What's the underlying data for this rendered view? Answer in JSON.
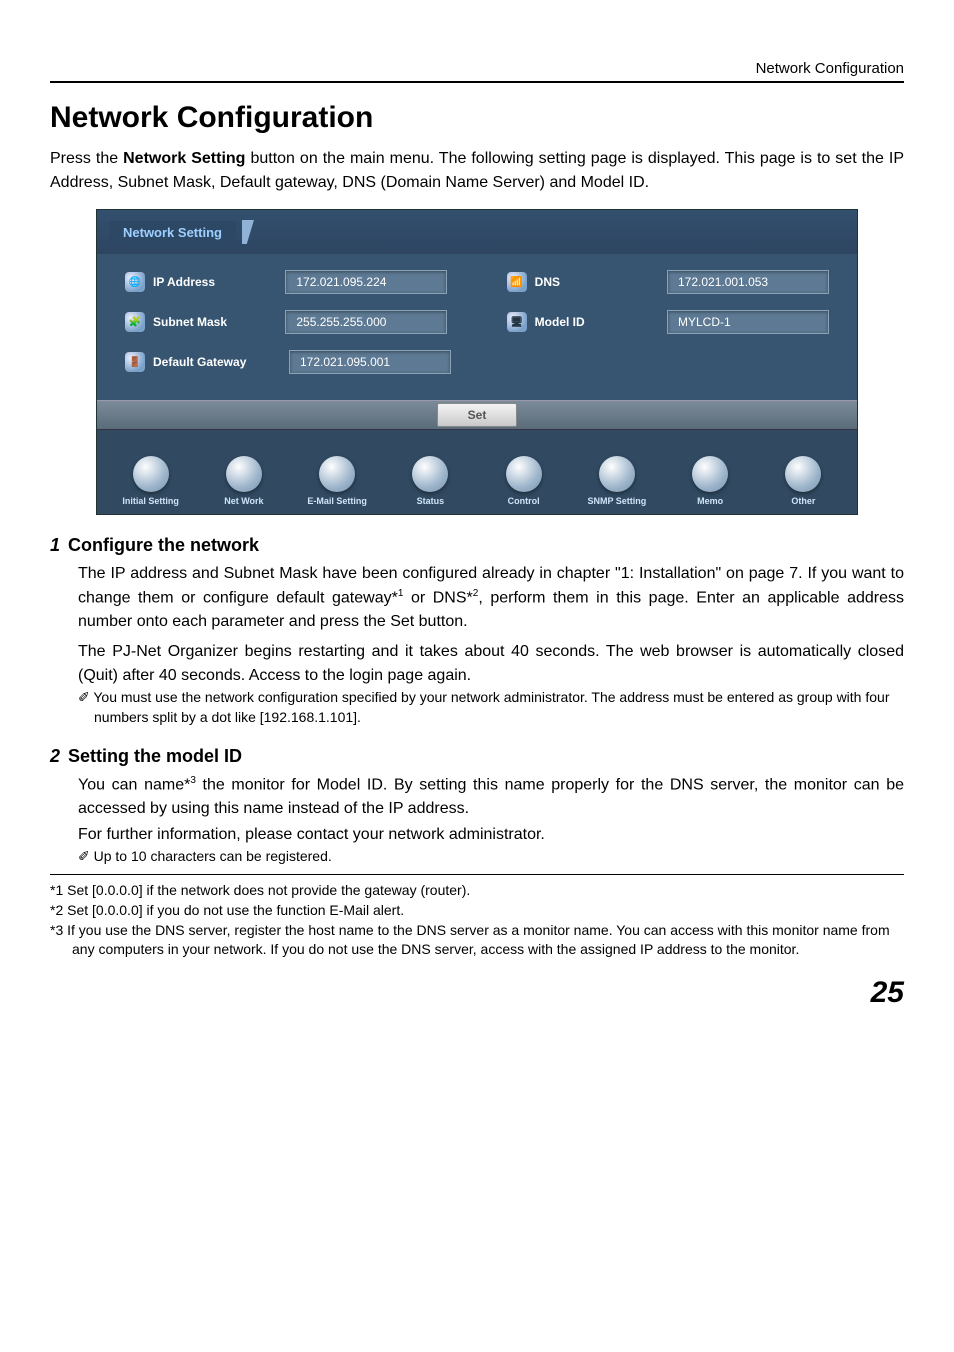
{
  "running_header": "Network Configuration",
  "title": "Network Configuration",
  "intro": "Press the Network Setting button on the main menu. The following setting page is displayed. This page is to set the IP Address, Subnet Mask, Default gateway, DNS (Domain Name Server) and Model ID.",
  "screenshot": {
    "tab_title": "Network Setting",
    "fields": {
      "ip_address": {
        "label": "IP Address",
        "value": "172.021.095.224"
      },
      "subnet_mask": {
        "label": "Subnet Mask",
        "value": "255.255.255.000"
      },
      "default_gateway": {
        "label": "Default Gateway",
        "value": "172.021.095.001"
      },
      "dns": {
        "label": "DNS",
        "value": "172.021.001.053"
      },
      "model_id": {
        "label": "Model ID",
        "value": "MYLCD-1"
      }
    },
    "set_button": "Set",
    "nav": [
      "Initial Setting",
      "Net Work",
      "E-Mail Setting",
      "Status",
      "Control",
      "SNMP Setting",
      "Memo",
      "Other"
    ]
  },
  "sections": [
    {
      "num": "1",
      "title": "Configure the network",
      "body1": "The IP address and Subnet Mask have been configured already in chapter \"1: Installation\" on page 7. If you want to change them or configure default gateway*",
      "sup1": "1",
      "body2": " or DNS*",
      "sup2": "2",
      "body3": ", perform them in this page. Enter an applicable address number onto each parameter and press the Set button.",
      "body4": "The PJ-Net Organizer begins restarting and it takes about 40 seconds. The web browser is automatically closed (Quit) after 40 seconds. Access to the login page again.",
      "note": "You must use the network configuration specified by your network administrator. The address must be entered as group with four numbers split by a dot like [192.168.1.101]."
    },
    {
      "num": "2",
      "title": "Setting the model ID",
      "body1": "You can name*",
      "sup1": "3",
      "body2": " the monitor for Model ID. By setting this name properly for the DNS server, the monitor can be accessed by using this name instead of the IP address.",
      "body3": "For further information, please contact your network administrator.",
      "note": "Up to 10 characters can be registered."
    }
  ],
  "footnotes": [
    "*1 Set [0.0.0.0] if the network does not provide the gateway (router).",
    "*2 Set [0.0.0.0] if you do not use the function E-Mail alert.",
    "*3 If you use the DNS server, register the host name to the DNS server as a monitor name. You can access with this monitor name from any computers in your network. If you do not use the DNS server, access with the assigned IP address to the monitor."
  ],
  "page_number": "25"
}
